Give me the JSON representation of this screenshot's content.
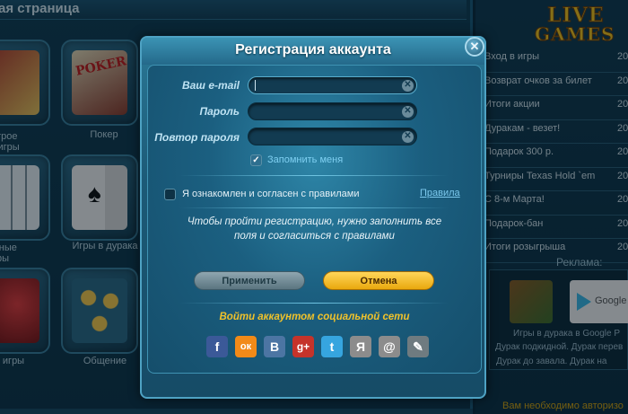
{
  "background": {
    "page_title": "ая страница",
    "tiles": [
      {
        "label_line1": "строе",
        "label_line2": "о игры"
      },
      {
        "label_line1": "Покер"
      },
      {
        "label_line1": "очные",
        "label_line2": "ры"
      },
      {
        "label_line1": "Игры в дурака"
      },
      {
        "label_line1": "игры"
      },
      {
        "label_line1": "Общение"
      }
    ],
    "poker_art_text": "POKER"
  },
  "right_panel": {
    "logo_line1": "LIVE",
    "logo_line2": "GAMES",
    "news": [
      {
        "title": "Вход в игры",
        "num": "20"
      },
      {
        "title": "Возврат очков за билет",
        "num": "20"
      },
      {
        "title": "Итоги акции",
        "num": "20"
      },
      {
        "title": "Дуракам - везет!",
        "num": "20"
      },
      {
        "title": "Подарок 300 р.",
        "num": "20"
      },
      {
        "title": "Турниры Texas Hold `em",
        "num": "20"
      },
      {
        "title": "С 8-м Марта!",
        "num": "20"
      },
      {
        "title": "Подарок-бан",
        "num": "20"
      },
      {
        "title": "Итоги розыгрыша",
        "num": "20"
      }
    ],
    "ads_title": "Реклама:",
    "ad_thumb2_text": "Google",
    "ad_line1": "Игры в дурака в Google P",
    "ad_line2": "Дурак подкидной. Дурак перев",
    "ad_line3": "Дурак до завала. Дурак на",
    "auth_note": "Вам необходимо авторизо"
  },
  "modal": {
    "title": "Регистрация аккаунта",
    "close_symbol": "✕",
    "email_label": "Ваш e-mail",
    "email_value": "",
    "password_label": "Пароль",
    "password_value": "",
    "repeat_label": "Повтор пароля",
    "repeat_value": "",
    "clear_symbol": "✕",
    "remember_label": "Запомнить меня",
    "remember_checked": true,
    "check_symbol": "✓",
    "agree_label": "Я ознакомлен и согласен с правилами",
    "agree_checked": false,
    "rules_link": "Правила",
    "info_line1": "Чтобы пройти регистрацию, нужно заполнить все",
    "info_line2": "поля и согласиться с правилами",
    "apply_label": "Применить",
    "cancel_label": "Отмена",
    "social_title": "Войти аккаунтом социальной сети",
    "social": [
      {
        "icon": "facebook-icon",
        "glyph": "f",
        "color": "#3b5998"
      },
      {
        "icon": "odnoklassniki-icon",
        "glyph": "ок",
        "color": "#f28a18"
      },
      {
        "icon": "vkontakte-icon",
        "glyph": "B",
        "color": "#4c75a3"
      },
      {
        "icon": "google-plus-icon",
        "glyph": "g+",
        "color": "#c5332a"
      },
      {
        "icon": "twitter-icon",
        "glyph": "t",
        "color": "#36a5df"
      },
      {
        "icon": "yandex-icon",
        "glyph": "Я",
        "color": "#8c8c8c"
      },
      {
        "icon": "mail-icon",
        "glyph": "@",
        "color": "#8c8c8c"
      },
      {
        "icon": "livejournal-icon",
        "glyph": "✎",
        "color": "#6f7b80"
      }
    ]
  },
  "colors": {
    "accent_gold": "#f0c22a",
    "link_blue": "#7cc9ee",
    "modal_blue": "#1c5a77"
  }
}
